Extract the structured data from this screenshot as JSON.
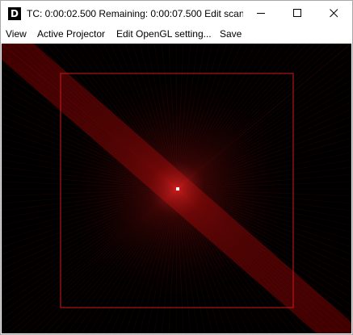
{
  "window": {
    "app_icon_letter": "D",
    "title": "TC: 0:00:02.500  Remaining: 0:00:07.500  Edit scan..."
  },
  "title_buttons": {
    "minimize": "minimize-icon",
    "maximize": "maximize-icon",
    "close": "close-icon"
  },
  "menu": {
    "items": [
      "View",
      "Active Projector",
      "Edit OpenGL setting...",
      "Save"
    ]
  },
  "viewport": {
    "background_color": "#000000",
    "beam_color": "#ff2020",
    "hotspot_color": "#ffffff"
  }
}
